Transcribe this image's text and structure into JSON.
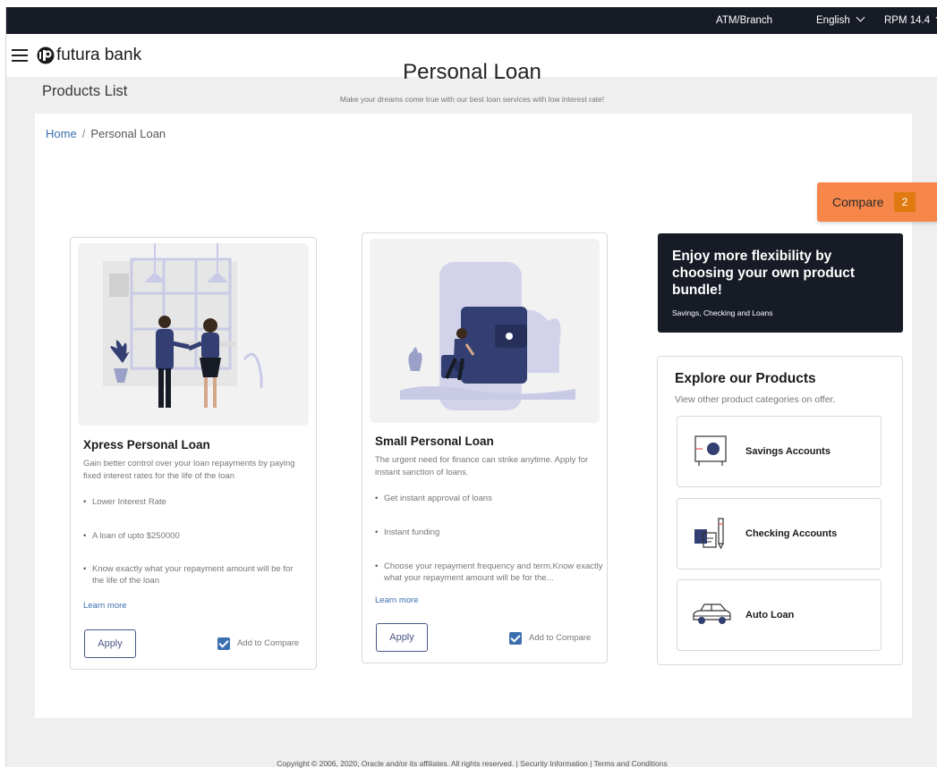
{
  "topbar": {
    "atm_branch": "ATM/Branch",
    "language": "English",
    "user": "RPM 14.4"
  },
  "header": {
    "brand": "futura bank"
  },
  "page_title": "Products List",
  "breadcrumb": {
    "home": "Home",
    "separator": "/",
    "current": "Personal Loan"
  },
  "hero": {
    "title": "Personal Loan",
    "subtitle": "Make your dreams come true with our best loan services with low interest rate!"
  },
  "compare": {
    "label": "Compare",
    "count": "2"
  },
  "products": [
    {
      "title": "Xpress Personal Loan",
      "description": "Gain better control over your loan repayments by paying fixed interest rates for the life of the loan",
      "features": [
        "Lower Interest Rate",
        "A loan of upto $250000",
        "Know exactly what your repayment amount will be for the life of the loan"
      ],
      "learn_more": "Learn more",
      "apply": "Apply",
      "add_to_compare": "Add to Compare",
      "compare_checked": true
    },
    {
      "title": "Small Personal Loan",
      "description": "The urgent need for finance can strike anytime. Apply for instant sanction of loans.",
      "features": [
        "Get instant approval of loans",
        "Instant funding",
        "Choose your repayment frequency and term.Know exactly what your repayment amount will be for the..."
      ],
      "learn_more": "Learn more",
      "apply": "Apply",
      "add_to_compare": "Add to Compare",
      "compare_checked": true
    }
  ],
  "promo": {
    "title": "Enjoy more flexibility by choosing your own product bundle!",
    "subtitle": "Savings, Checking and Loans"
  },
  "explore": {
    "title": "Explore our Products",
    "subtitle": "View other product categories on offer.",
    "categories": [
      {
        "label": "Savings Accounts",
        "icon": "safe-icon"
      },
      {
        "label": "Checking Accounts",
        "icon": "cheque-icon"
      },
      {
        "label": "Auto Loan",
        "icon": "car-icon"
      }
    ]
  },
  "footer": {
    "text": "Copyright © 2006, 2020, Oracle and/or its affiliates. All rights reserved. | Security Information | Terms and Conditions"
  },
  "colors": {
    "topbar": "#161b26",
    "accent_blue": "#3b6fb0",
    "compare_orange": "#f7864a",
    "compare_badge": "#e07a10",
    "illustration_navy": "#333f72",
    "illustration_lavender": "#c9cbe6"
  }
}
